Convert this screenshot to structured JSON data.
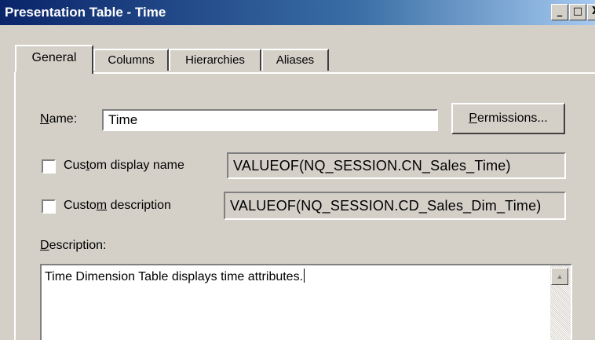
{
  "window": {
    "title": "Presentation Table - Time",
    "minimize_glyph": "_",
    "maximize_glyph": "□",
    "close_glyph": "X"
  },
  "tabs": [
    {
      "label": "General",
      "active": true
    },
    {
      "label": "Columns",
      "active": false
    },
    {
      "label": "Hierarchies",
      "active": false
    },
    {
      "label": "Aliases",
      "active": false
    }
  ],
  "general": {
    "name_label_mn": "N",
    "name_label_rest": "ame:",
    "name_value": "Time",
    "permissions_mn": "P",
    "permissions_rest": "ermissions...",
    "custom_display": {
      "label_pre": "Cus",
      "label_mn": "t",
      "label_post": "om display name",
      "checked": false,
      "value": "VALUEOF(NQ_SESSION.CN_Sales_Time)"
    },
    "custom_description": {
      "label_pre": "Custo",
      "label_mn": "m",
      "label_post": " description",
      "checked": false,
      "value": "VALUEOF(NQ_SESSION.CD_Sales_Dim_Time)"
    },
    "description_label_mn": "D",
    "description_label_rest": "escription:",
    "description_value": "Time Dimension Table displays time attributes."
  },
  "icons": {
    "scroll_up": "triangle-up"
  }
}
